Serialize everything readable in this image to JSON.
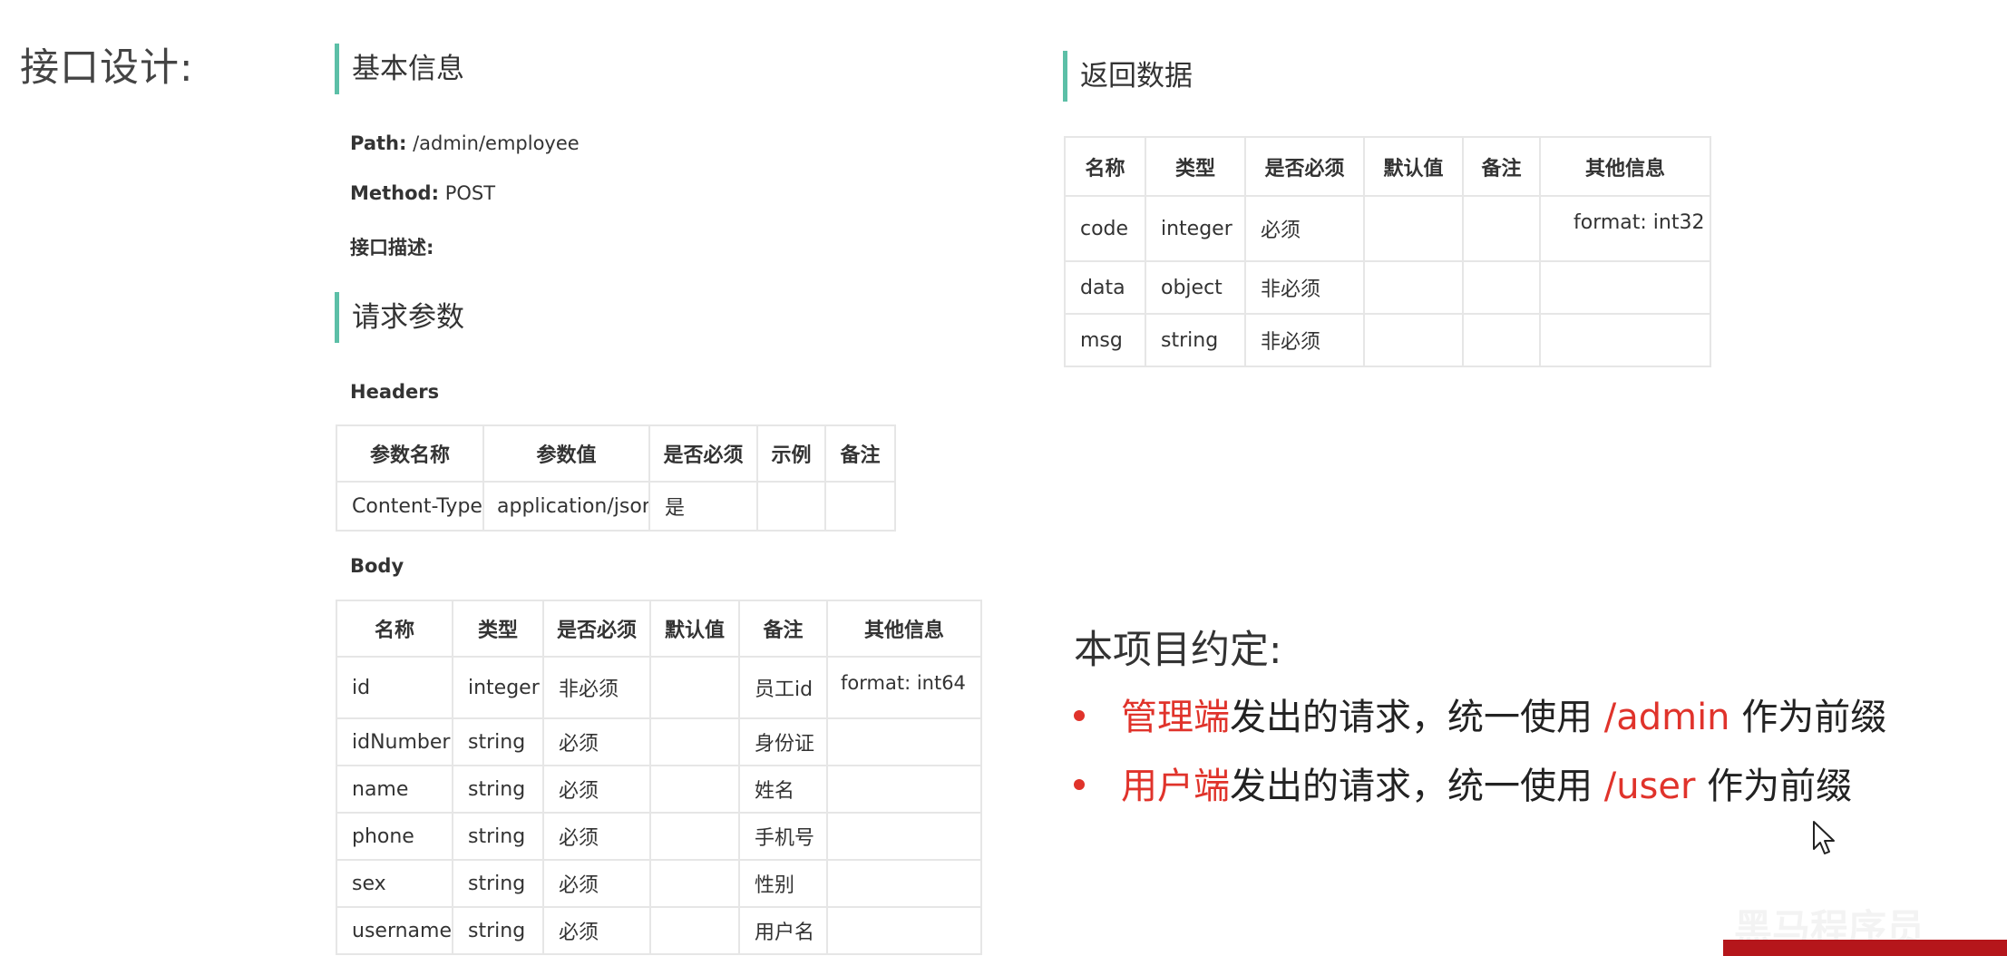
{
  "slide_title": "接口设计:",
  "basic_info": {
    "heading": "基本信息",
    "path_label": "Path:",
    "path_value": "/admin/employee",
    "method_label": "Method:",
    "method_value": "POST",
    "desc_label": "接口描述:"
  },
  "request_params": {
    "heading": "请求参数",
    "headers_label": "Headers",
    "headers_table": {
      "columns": [
        "参数名称",
        "参数值",
        "是否必须",
        "示例",
        "备注"
      ],
      "rows": [
        [
          "Content-Type",
          "application/json",
          "是",
          "",
          ""
        ]
      ]
    },
    "body_label": "Body",
    "body_table": {
      "columns": [
        "名称",
        "类型",
        "是否必须",
        "默认值",
        "备注",
        "其他信息"
      ],
      "rows": [
        [
          "id",
          "integer",
          "非必须",
          "",
          "员工id",
          "format: int64"
        ],
        [
          "idNumber",
          "string",
          "必须",
          "",
          "身份证",
          ""
        ],
        [
          "name",
          "string",
          "必须",
          "",
          "姓名",
          ""
        ],
        [
          "phone",
          "string",
          "必须",
          "",
          "手机号",
          ""
        ],
        [
          "sex",
          "string",
          "必须",
          "",
          "性别",
          ""
        ],
        [
          "username",
          "string",
          "必须",
          "",
          "用户名",
          ""
        ]
      ]
    }
  },
  "response": {
    "heading": "返回数据",
    "table": {
      "columns": [
        "名称",
        "类型",
        "是否必须",
        "默认值",
        "备注",
        "其他信息"
      ],
      "rows": [
        [
          "code",
          "integer",
          "必须",
          "",
          "",
          "format: int32"
        ],
        [
          "data",
          "object",
          "非必须",
          "",
          "",
          ""
        ],
        [
          "msg",
          "string",
          "非必须",
          "",
          "",
          ""
        ]
      ]
    }
  },
  "convention": {
    "title": "本项目约定:",
    "bullets": [
      {
        "highlight": "管理端",
        "middle": "发出的请求，统一使用 ",
        "prefix": "/admin",
        "end": " 作为前缀"
      },
      {
        "highlight": "用户端",
        "middle": "发出的请求，统一使用 ",
        "prefix": "/user",
        "end": " 作为前缀"
      }
    ]
  },
  "watermark": "黑马程序员",
  "colors": {
    "accent": "#5cbfa7",
    "highlight": "#e0332b",
    "border": "#e6e6e6"
  },
  "icons": {
    "cursor": "mouse-pointer-icon"
  }
}
